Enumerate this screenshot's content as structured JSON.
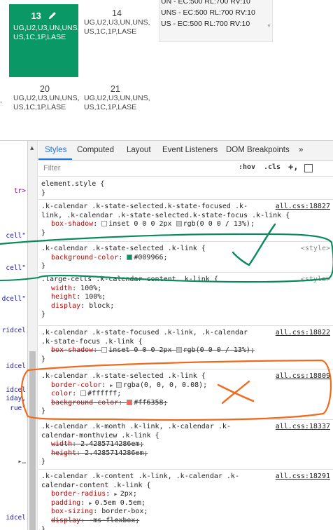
{
  "calendar": {
    "selected_cell": {
      "day": "13",
      "lines": [
        "UG,U2,U3,UN,UNS,",
        "US,1C,1P,LASE"
      ],
      "color": "#0a9966"
    },
    "cell_14": {
      "day": "14",
      "lines": [
        "UG,U2,U3,UN,UNS,",
        "US,1C,1P,LASE"
      ]
    },
    "cell_20": {
      "day": "20",
      "lines": [
        "UG,U2,U3,UN,UNS,",
        "US,1C,1P,LASE"
      ]
    },
    "cell_21": {
      "day": "21",
      "lines": [
        "UG,U2,U3,UN,UNS,",
        "US,1C,1P,LASE"
      ]
    },
    "left_fragment": ",",
    "schedule_list": [
      "UN - EC:500 RL:700 RV:10",
      "UNS - EC:500 RL:700 RV:10",
      "US - EC:500 RL:700 RV:10"
    ]
  },
  "elements_fragments": [
    {
      "text": "tr>",
      "kind": "tag"
    },
    {
      "text": "cell\"",
      "kind": "attr"
    },
    {
      "text": "cell\"",
      "kind": "attr"
    },
    {
      "text": "dcell\"",
      "kind": "attr"
    },
    {
      "text": "ridcel",
      "kind": "attr"
    },
    {
      "text": "idcel",
      "kind": "attr"
    },
    {
      "text": "idcel",
      "kind": "attr"
    },
    {
      "text": "iday,",
      "kind": "attr"
    },
    {
      "text": "rue\"",
      "kind": "attr"
    },
    {
      "text": "▸…",
      "kind": "sel"
    },
    {
      "text": "idcel",
      "kind": "attr"
    }
  ],
  "devtools": {
    "tabs": [
      "Styles",
      "Computed",
      "Layout",
      "Event Listeners",
      "DOM Breakpoints",
      "»"
    ],
    "active_tab": "Styles",
    "filter_placeholder": "Filter",
    "hov_label": ":hov",
    "cls_label": ".cls",
    "plus_label": "+,",
    "rules": [
      {
        "selector": [
          "element.style {"
        ],
        "decls": [],
        "source": ""
      },
      {
        "selector": [
          ".k-calendar .k-state-selected.k-state-focused .k-",
          "link, .k-calendar .k-state-selected.k-state-focus .k-link {"
        ],
        "decls": [
          {
            "prop": "box-shadow",
            "val": "inset 0 0 0 2px ",
            "val2": "rgb(0 0 0 / 13%);",
            "swatch": "#c8c8c8",
            "strike": false
          }
        ],
        "source": "all.css:18827"
      },
      {
        "selector": [
          ".k-calendar .k-state-selected .k-link {"
        ],
        "decls": [
          {
            "prop": "background-color",
            "val": "#009966;",
            "swatch": "#009966",
            "strike": false
          }
        ],
        "source": "<style>"
      },
      {
        "selector": [
          ".large-cells .k-calendar-content .k-link {"
        ],
        "decls": [
          {
            "prop": "width",
            "val": "100%;",
            "strike": false
          },
          {
            "prop": "height",
            "val": "100%;",
            "strike": false
          },
          {
            "prop": "display",
            "val": "block;",
            "strike": false
          }
        ],
        "source": "<style>"
      },
      {
        "selector": [
          ".k-calendar .k-state-focused .k-link, .k-calendar",
          ".k-state-focus .k-link {"
        ],
        "decls": [
          {
            "prop": "box-shadow",
            "val": "inset 0 0 0 2px ",
            "val2": "rgb(0 0 0 / 13%);",
            "swatch": "#c8c8c8",
            "strike": true
          }
        ],
        "source": "all.css:18822"
      },
      {
        "selector": [
          ".k-calendar .k-state-selected .k-link {"
        ],
        "decls": [
          {
            "prop": "border-color",
            "val": "rgba(0, 0, 0, 0.08);",
            "swatch": "#d9d9d9",
            "tri": true,
            "strike": false
          },
          {
            "prop": "color",
            "val": "#ffffff;",
            "swatch": "#ffffff",
            "strike": false
          },
          {
            "prop": "background-color",
            "val": "#ff6358;",
            "swatch": "#ff6358",
            "strike": true
          }
        ],
        "source": "all.css:18809"
      },
      {
        "selector": [
          ".k-calendar .k-month .k-link, .k-calendar .k-",
          "calendar-monthview .k-link {"
        ],
        "decls": [
          {
            "prop": "width",
            "val": "2.4285714286em;",
            "strike": true
          },
          {
            "prop": "height",
            "val": "2.4285714286em;",
            "strike": true
          }
        ],
        "source": "all.css:18337"
      },
      {
        "selector": [
          ".k-calendar .k-content .k-link, .k-calendar .k-",
          "calendar-content .k-link {"
        ],
        "decls": [
          {
            "prop": "border-radius",
            "val": "2px;",
            "tri": true,
            "strike": false
          },
          {
            "prop": "padding",
            "val": "0.5em 0.5em;",
            "tri": true,
            "strike": false
          },
          {
            "prop": "box-sizing",
            "val": "border-box;",
            "strike": false
          },
          {
            "prop": "display",
            "val": "-ms-flexbox;",
            "strike": true
          }
        ],
        "source": "all.css:18291"
      }
    ]
  },
  "annotation_colors": {
    "green": "#0a8a5a",
    "orange": "#f06a1e"
  }
}
